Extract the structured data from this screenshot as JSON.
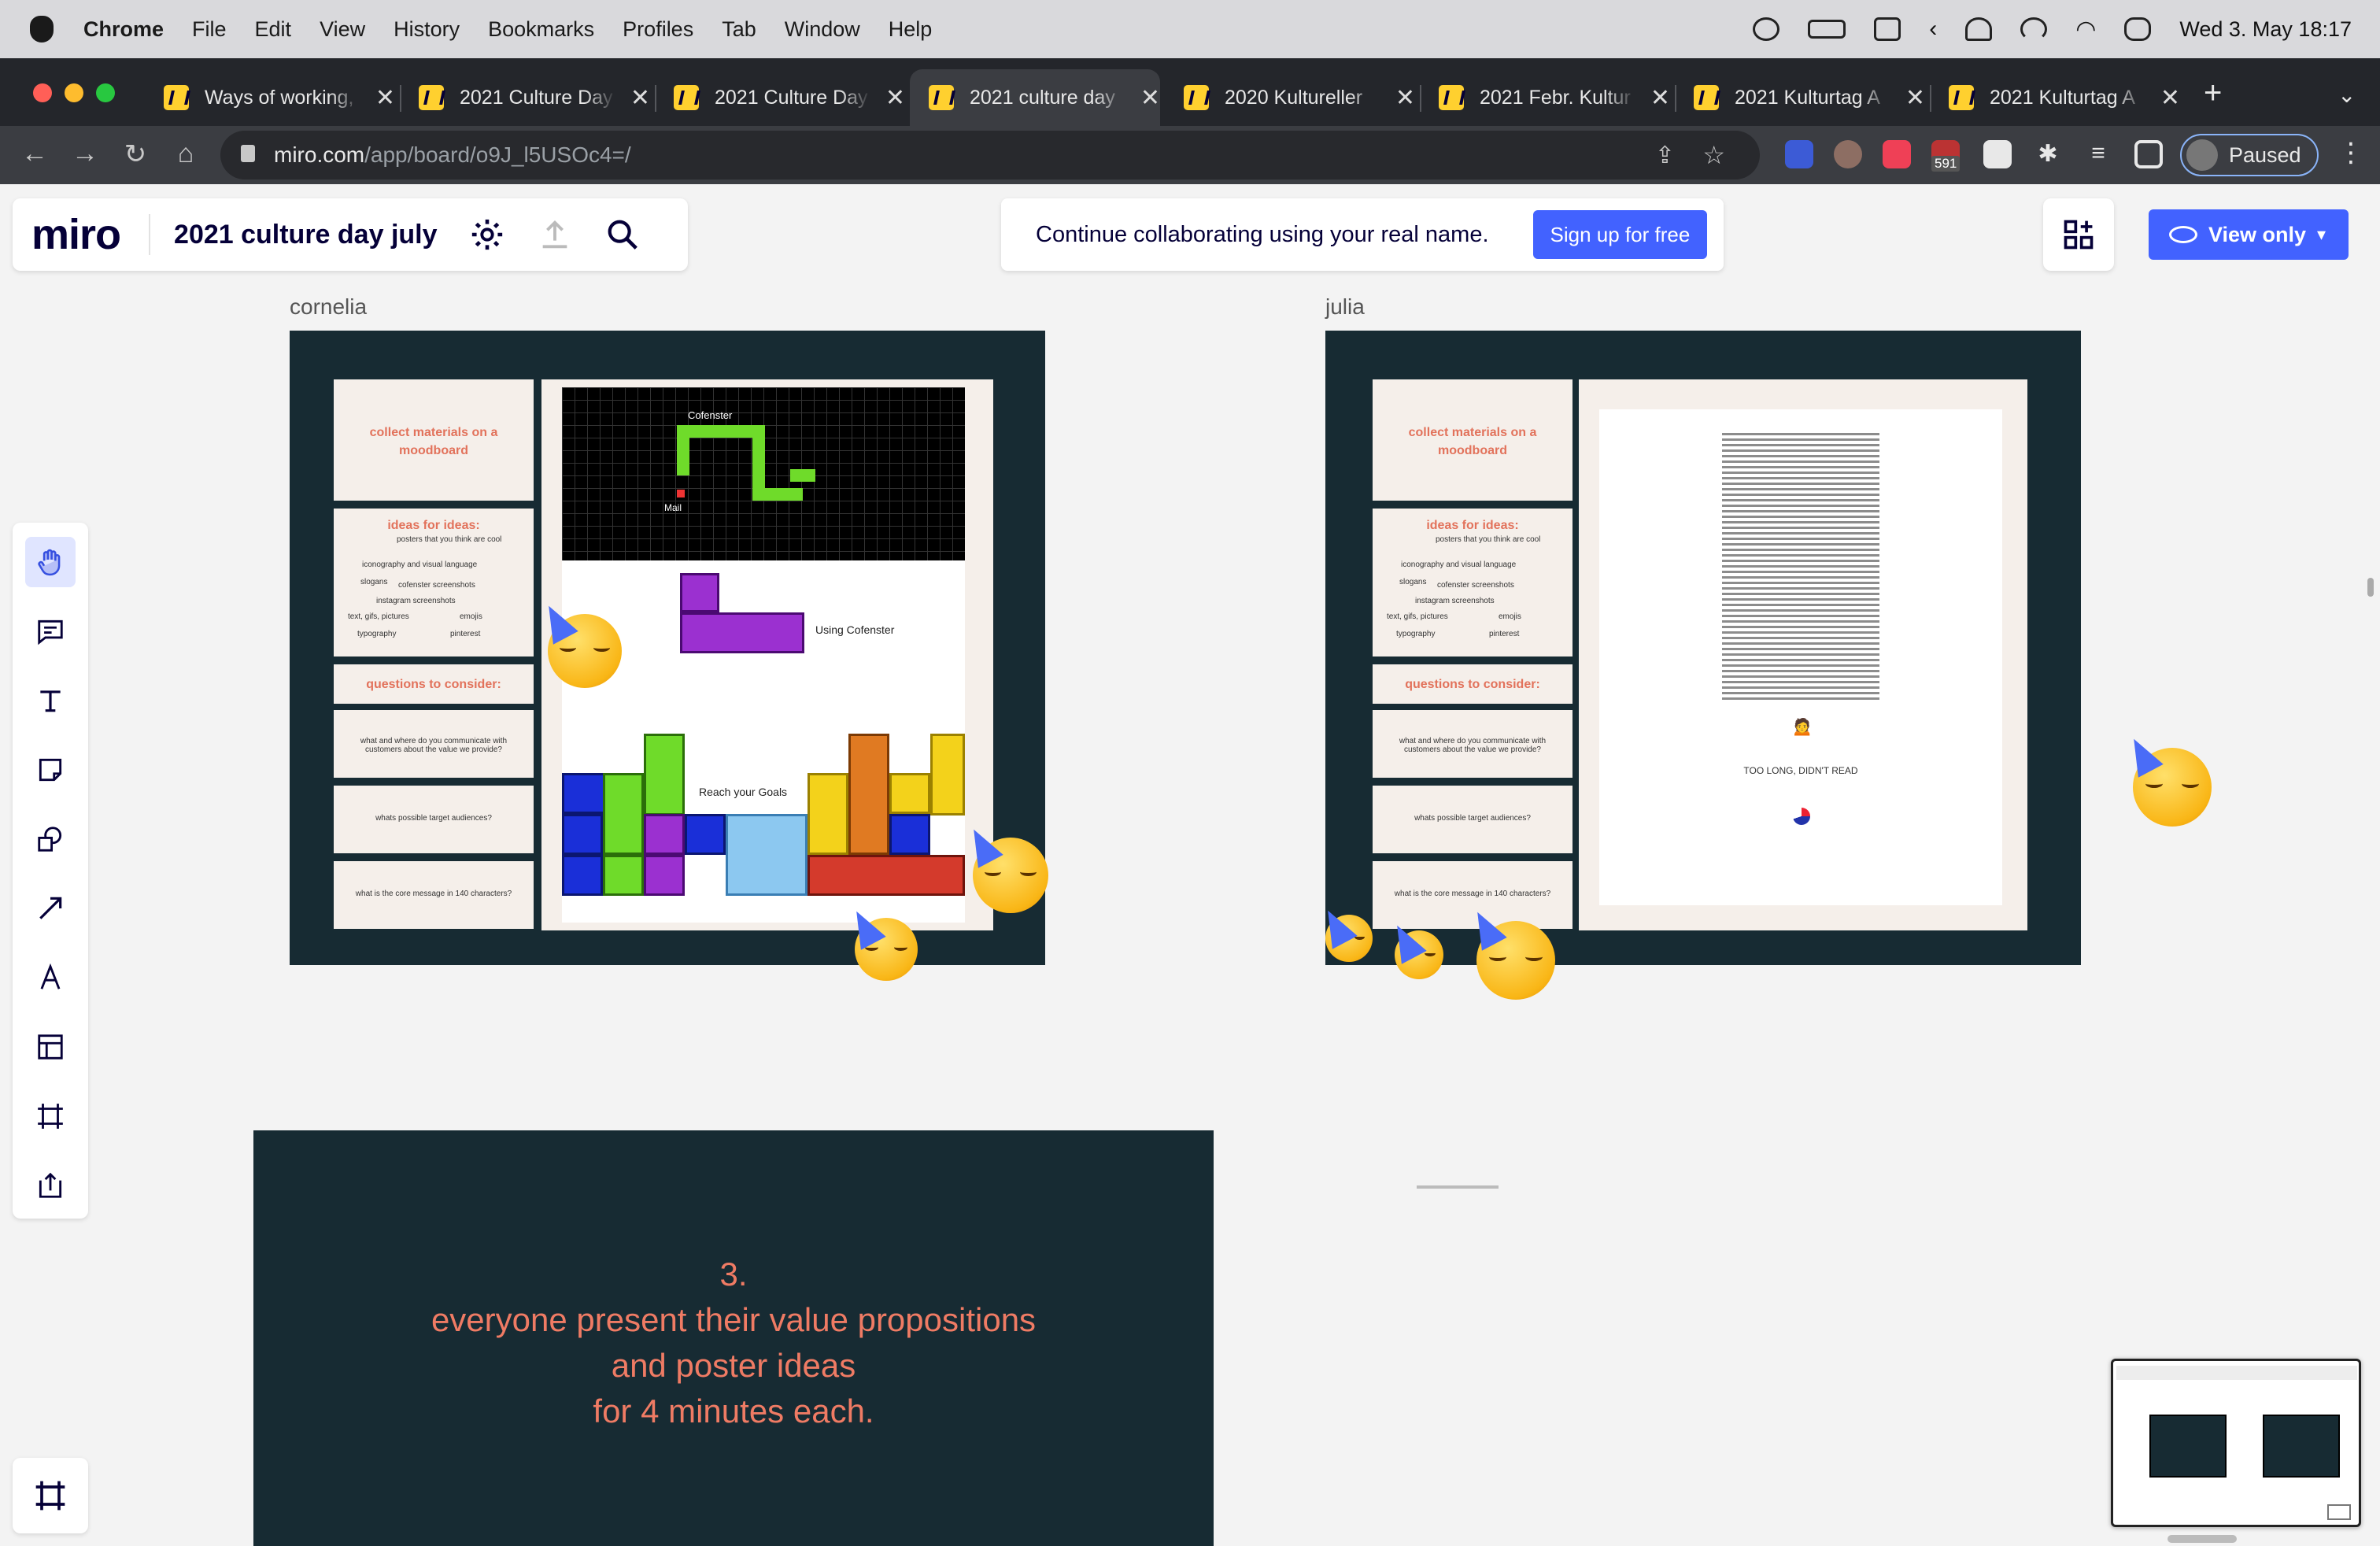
{
  "menubar": {
    "app": "Chrome",
    "items": [
      "File",
      "Edit",
      "View",
      "History",
      "Bookmarks",
      "Profiles",
      "Tab",
      "Window",
      "Help"
    ],
    "clock": "Wed 3. May  18:17"
  },
  "tabs": [
    {
      "title": "Ways of working,"
    },
    {
      "title": "2021 Culture Day"
    },
    {
      "title": "2021 Culture Day"
    },
    {
      "title": "2021 culture day"
    },
    {
      "title": "2020 Kultureller"
    },
    {
      "title": "2021 Febr. Kultur"
    },
    {
      "title": "2021 Kulturtag A"
    },
    {
      "title": "2021 Kulturtag A"
    }
  ],
  "address": {
    "domain": "miro.com",
    "path": "/app/board/o9J_l5USOc4=/"
  },
  "profile": {
    "label": "Paused"
  },
  "extensions": {
    "badge": "591"
  },
  "miro": {
    "logo": "miro",
    "board_name": "2021 culture day july",
    "banner_text": "Continue collaborating using your real name.",
    "signup_label": "Sign up for free",
    "view_only_label": "View only"
  },
  "frames": {
    "cornelia": {
      "label": "cornelia",
      "tetris_labels": {
        "cofenster": "Cofenster",
        "mail": "Mail",
        "using": "Using Cofenster",
        "goals": "Reach your Goals"
      }
    },
    "julia": {
      "label": "julia",
      "tldr": "TOO LONG, DIDN'T READ"
    }
  },
  "cards": {
    "collect": "collect materials on a moodboard",
    "ideas_title": "ideas for ideas:",
    "ideas_items": [
      "posters that you think are cool",
      "iconography and visual language",
      "slogans",
      "cofenster screenshots",
      "instagram screenshots",
      "text, gifs, pictures",
      "emojis",
      "typography",
      "pinterest"
    ],
    "questions_title": "questions to consider:",
    "q1": "what and where do you communicate with customers about the value we provide?",
    "q2": "whats possible target audiences?",
    "q3": "what is the core message in 140 characters?"
  },
  "slide3": {
    "lines": [
      "3.",
      "everyone present their value propositions",
      "and poster ideas",
      "for 4 minutes each."
    ]
  },
  "colors": {
    "miro_blue": "#4262ff",
    "frame_dark": "#172b33",
    "accent_coral": "#e2725b",
    "miro_yellow": "#ffd02f"
  }
}
